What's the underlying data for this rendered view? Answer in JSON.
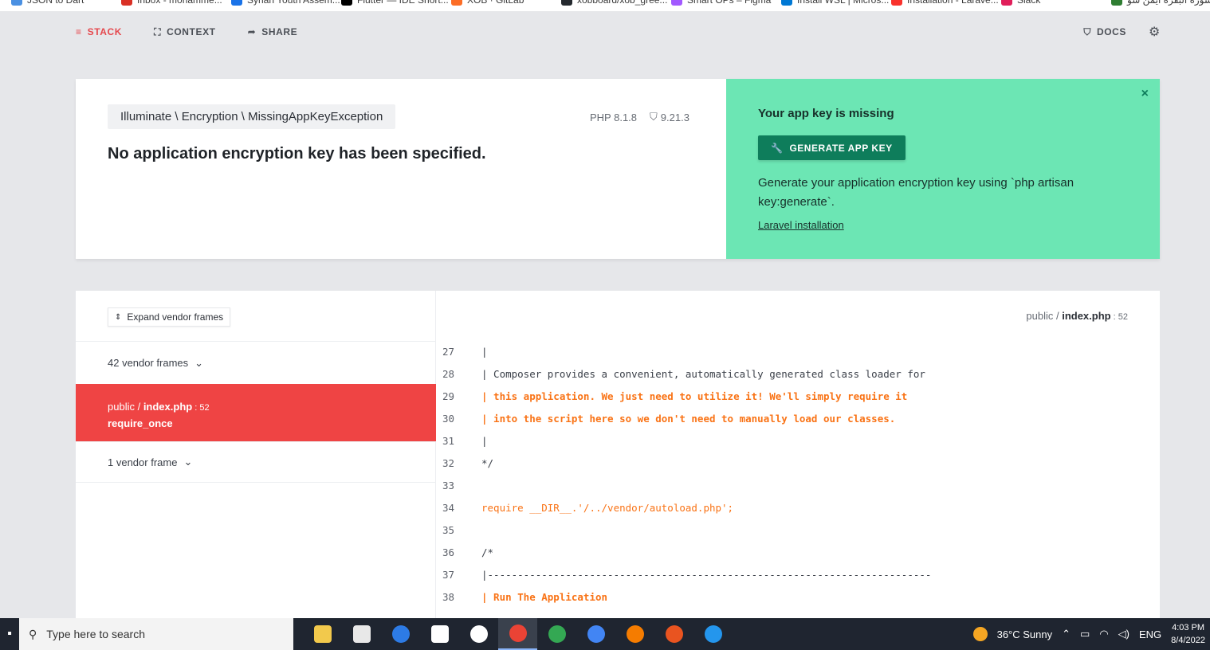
{
  "bookmarks": [
    "JSON to Dart",
    "Inbox - mohamme...",
    "Syrian Youth Assem...",
    "Flutter — IDE Short...",
    "XOB · GitLab",
    "xobboard/xob_gree...",
    "Smart OPs – Figma",
    "Install WSL | Micros...",
    "Installation - Larave...",
    "Slack",
    "سورة البقرة ايمن سو..."
  ],
  "nav": {
    "stack": "STACK",
    "context": "CONTEXT",
    "share": "SHARE",
    "docs": "DOCS"
  },
  "exception": {
    "class": "Illuminate \\ Encryption \\ MissingAppKeyException",
    "message": "No application encryption key has been specified.",
    "php_version": "PHP 8.1.8",
    "laravel_version": "9.21.3"
  },
  "solution": {
    "title": "Your app key is missing",
    "button": "GENERATE APP KEY",
    "description": "Generate your application encryption key using `php artisan key:generate`.",
    "link": "Laravel installation",
    "close": "×"
  },
  "frames": {
    "expand": "Expand vendor frames",
    "vendor_group_1": "42 vendor frames",
    "active_file_dir": "public / ",
    "active_file_name": "index.php",
    "active_line": " : 52",
    "active_method": "require_once",
    "vendor_group_2": "1 vendor frame"
  },
  "code_path": {
    "dir": "public / ",
    "file": "index.php",
    "line": " : 52"
  },
  "code_lines": [
    {
      "n": "27",
      "t": "|"
    },
    {
      "n": "28",
      "t": "| Composer provides a convenient, automatically generated class loader for"
    },
    {
      "n": "29",
      "t": "| this application. We just need to utilize it! We'll simply require it"
    },
    {
      "n": "30",
      "t": "| into the script here so we don't need to manually load our classes."
    },
    {
      "n": "31",
      "t": "|"
    },
    {
      "n": "32",
      "t": "*/"
    },
    {
      "n": "33",
      "t": ""
    },
    {
      "n": "34",
      "t": "require __DIR__.'/../vendor/autoload.php';"
    },
    {
      "n": "35",
      "t": ""
    },
    {
      "n": "36",
      "t": "/*"
    },
    {
      "n": "37",
      "t": "|--------------------------------------------------------------------------"
    },
    {
      "n": "38",
      "t": "| Run The Application"
    }
  ],
  "taskbar": {
    "search_placeholder": "Type here to search",
    "weather": "36°C  Sunny",
    "lang": "ENG",
    "time": "4:03 PM",
    "date": "8/4/2022"
  },
  "colors": {
    "accent_red": "#ef4444",
    "solution_green": "#6ce6b4",
    "button_green": "#0e7d5b",
    "code_keyword": "#f97316"
  }
}
